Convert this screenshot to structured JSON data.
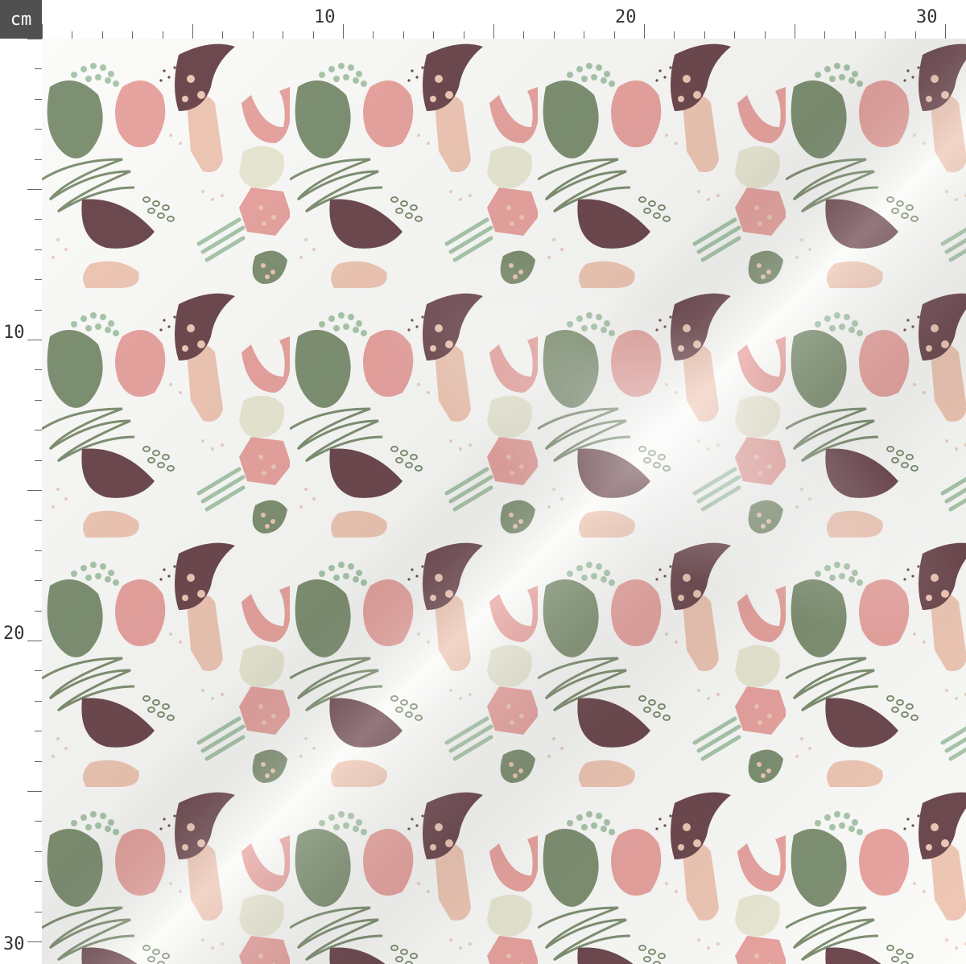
{
  "unit_label": "cm",
  "ruler": {
    "top_labels": [
      "10",
      "20",
      "30"
    ],
    "left_labels": [
      "10",
      "20",
      "30"
    ]
  },
  "image": {
    "kind": "fabric swatch with repeating abstract shapes print",
    "colors": {
      "background": "#fbfbf9",
      "blush_pink": "#e8a4a0",
      "peach": "#efc7b5",
      "sage_green": "#7f9173",
      "mint": "#a9c7ab",
      "plum": "#6e4a50",
      "cream": "#e9e8d4",
      "ruler_box": "#505050"
    }
  }
}
